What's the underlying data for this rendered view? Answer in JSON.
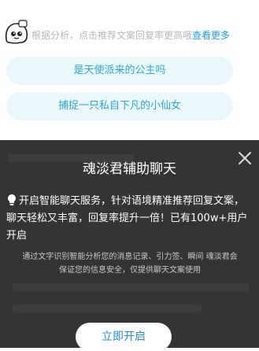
{
  "top": {
    "hint_prefix": "根据分析，点击推荐文案回复率更高哦",
    "hint_link": "查看更多",
    "suggestions": [
      "是天使派来的公主吗",
      "捕捉一只私自下凡的小仙女"
    ]
  },
  "dialog": {
    "title": "魂淡君辅助聊天",
    "description": "开启智能聊天服务，针对语境精准推荐回复文案，聊天轻松又丰富，回复率提升一倍！已有100w+用户开启",
    "subtext": "通过文字识别智能分析您的消息记录、引力签、瞬间 魂淡君会保证您的信息安全，仅提供聊天文案使用",
    "button_label": "立即开启",
    "close_icon": "close-icon"
  }
}
